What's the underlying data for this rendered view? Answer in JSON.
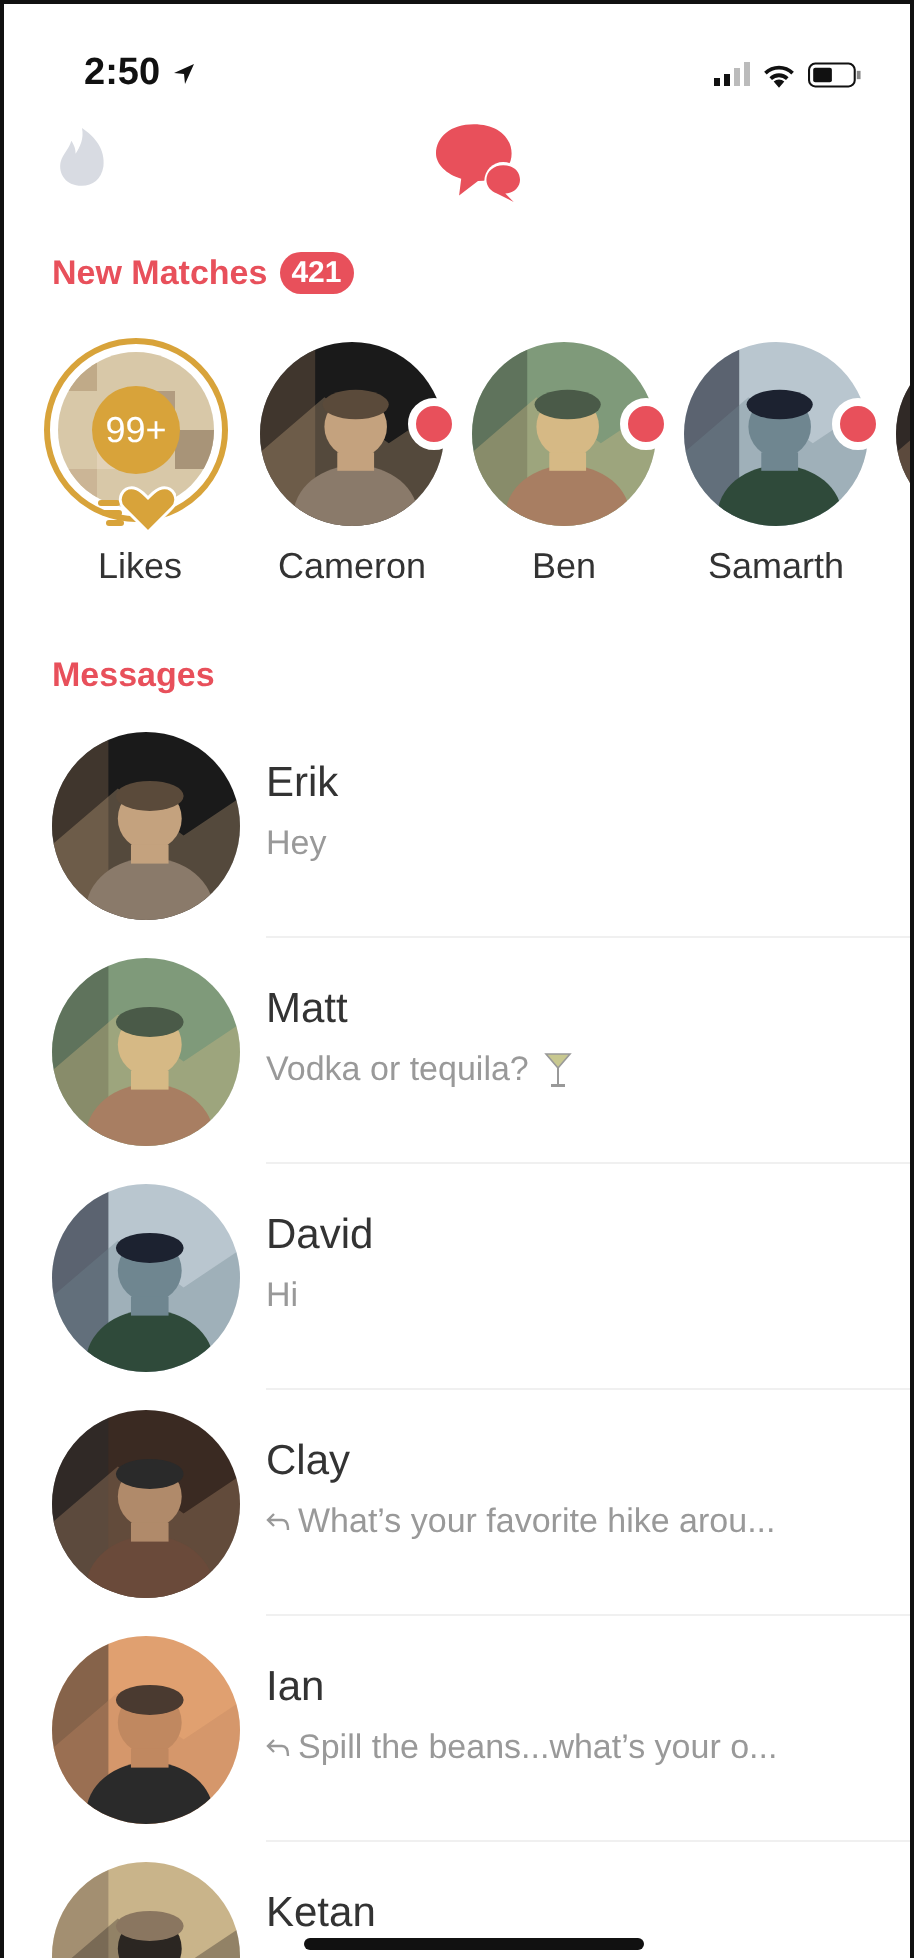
{
  "status_bar": {
    "time": "2:50"
  },
  "new_matches": {
    "title": "New Matches",
    "count": "421",
    "items": [
      {
        "kind": "likes",
        "name": "Likes",
        "badge": "99+",
        "unread": false
      },
      {
        "kind": "person",
        "name": "Cameron",
        "unread": true
      },
      {
        "kind": "person",
        "name": "Ben",
        "unread": true
      },
      {
        "kind": "person",
        "name": "Samarth",
        "unread": true
      },
      {
        "kind": "partial",
        "unread": false
      }
    ]
  },
  "messages": {
    "title": "Messages",
    "items": [
      {
        "name": "Erik",
        "preview": "Hey",
        "replied": false
      },
      {
        "name": "Matt",
        "preview": "Vodka or tequila?",
        "replied": false,
        "emoji": true
      },
      {
        "name": "David",
        "preview": "Hi",
        "replied": false
      },
      {
        "name": "Clay",
        "preview": "What’s your favorite hike arou...",
        "replied": true
      },
      {
        "name": "Ian",
        "preview": "Spill the beans...what’s your o...",
        "replied": true
      },
      {
        "name": "Ketan",
        "replied": false
      }
    ]
  }
}
